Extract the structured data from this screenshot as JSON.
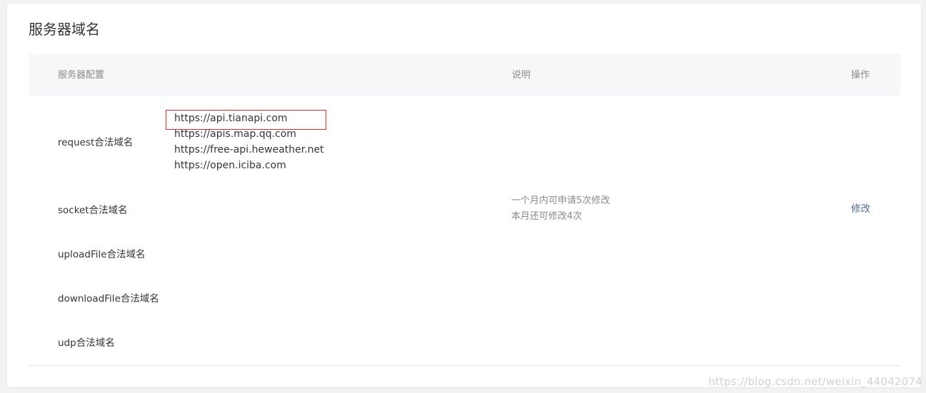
{
  "section": {
    "title": "服务器域名"
  },
  "table": {
    "headers": {
      "config": "服务器配置",
      "description": "说明",
      "action": "操作"
    },
    "rows": [
      {
        "label": "request合法域名",
        "domains": [
          "https://api.tianapi.com",
          "https://apis.map.qq.com",
          "https://free-api.heweather.net",
          "https://open.iciba.com"
        ]
      },
      {
        "label": "socket合法域名"
      },
      {
        "label": "uploadFile合法域名"
      },
      {
        "label": "downloadFile合法域名"
      },
      {
        "label": "udp合法域名"
      }
    ],
    "description_lines": [
      "一个月内可申请5次修改",
      "本月还可修改4次"
    ],
    "action_label": "修改"
  },
  "watermark": "https://blog.csdn.net/weixin_44042074",
  "colors": {
    "link": "#576b95",
    "highlight_border": "#d9302b",
    "header_bg": "#f6f7f9"
  }
}
